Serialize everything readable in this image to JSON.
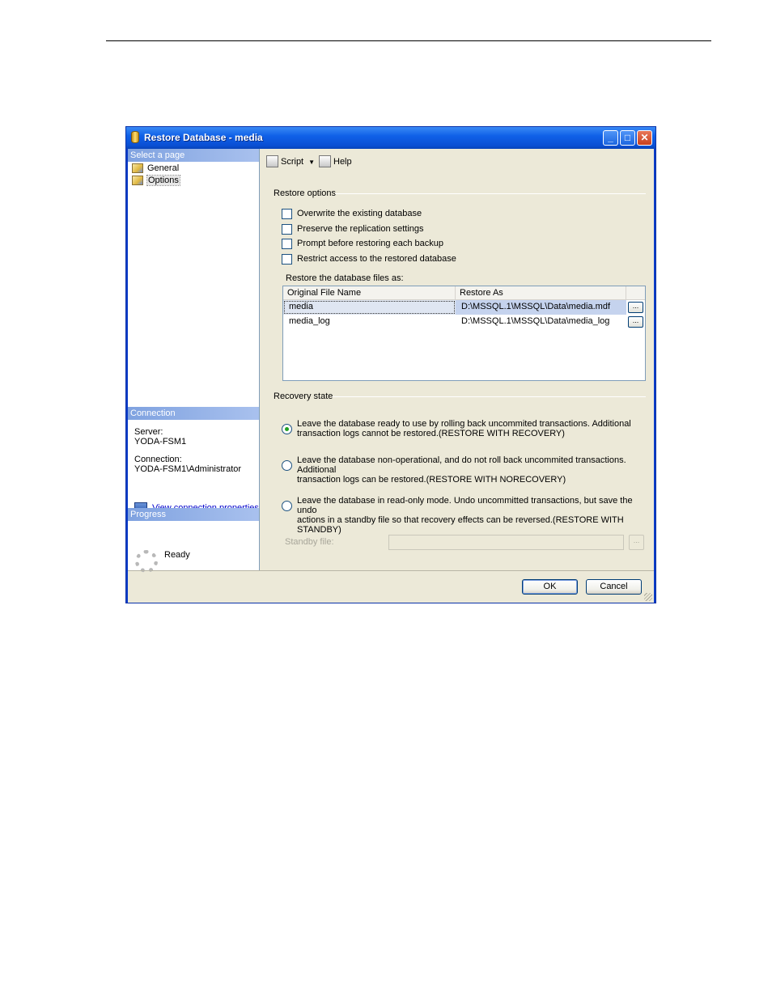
{
  "window": {
    "title": "Restore Database - media",
    "buttons": {
      "minimize": "_",
      "maximize": "□",
      "close": "✕"
    }
  },
  "leftpane": {
    "select_page_header": "Select a page",
    "pages": [
      {
        "label": "General",
        "icon": "page-icon"
      },
      {
        "label": "Options",
        "icon": "page-icon",
        "selected": true
      }
    ],
    "connection_header": "Connection",
    "server_label": "Server:",
    "server_value": "YODA-FSM1",
    "connection_label": "Connection:",
    "connection_value": "YODA-FSM1\\Administrator",
    "view_connection_link": "View connection properties",
    "progress_header": "Progress",
    "progress_status": "Ready"
  },
  "toolbar": {
    "script_label": "Script",
    "help_label": "Help"
  },
  "restore_options": {
    "title": "Restore options",
    "checkboxes": [
      {
        "label": "Overwrite the existing database",
        "checked": false
      },
      {
        "label": "Preserve the replication settings",
        "checked": false
      },
      {
        "label": "Prompt before restoring each backup",
        "checked": false
      },
      {
        "label": "Restrict access to the restored database",
        "checked": false
      }
    ],
    "files_label": "Restore the database files as:"
  },
  "files_grid": {
    "columns": [
      "Original File Name",
      "Restore As"
    ],
    "rows": [
      {
        "original": "media",
        "restore_as": "D:\\MSSQL.1\\MSSQL\\Data\\media.mdf",
        "browse": "..."
      },
      {
        "original": "media_log",
        "restore_as": "D:\\MSSQL.1\\MSSQL\\Data\\media_log",
        "browse": "..."
      }
    ]
  },
  "recovery_state": {
    "title": "Recovery state",
    "options": [
      {
        "line1": "Leave the database ready to use by rolling back uncommited transactions. Additional",
        "line2": "transaction logs cannot be restored.(RESTORE WITH RECOVERY)",
        "selected": true
      },
      {
        "line1": "Leave the database non-operational, and do not roll back uncommited transactions. Additional",
        "line2": "transaction logs can be restored.(RESTORE WITH NORECOVERY)",
        "selected": false
      },
      {
        "line1": "Leave the database in read-only mode. Undo uncommitted transactions, but save the undo",
        "line2": "actions in a standby file so that recovery effects can be reversed.(RESTORE WITH STANDBY)",
        "selected": false
      }
    ],
    "standby_label": "Standby file:",
    "standby_value": "",
    "standby_browse": "..."
  },
  "footer": {
    "ok_label": "OK",
    "cancel_label": "Cancel"
  }
}
